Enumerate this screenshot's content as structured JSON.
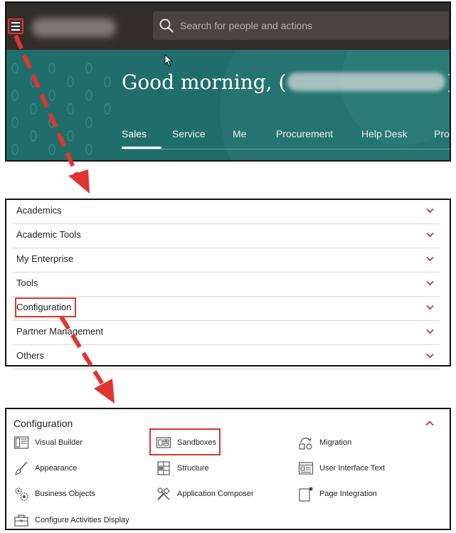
{
  "search": {
    "placeholder": "Search for people and actions"
  },
  "greeting": {
    "prefix": "Good morning, (",
    "suffix": ")!"
  },
  "tabs": [
    {
      "label": "Sales"
    },
    {
      "label": "Service"
    },
    {
      "label": "Me"
    },
    {
      "label": "Procurement"
    },
    {
      "label": "Help Desk"
    },
    {
      "label": "Pro"
    }
  ],
  "navigator": {
    "items": [
      {
        "label": "Academics"
      },
      {
        "label": "Academic Tools"
      },
      {
        "label": "My Enterprise"
      },
      {
        "label": "Tools"
      },
      {
        "label": "Configuration"
      },
      {
        "label": "Partner Management"
      },
      {
        "label": "Others"
      }
    ]
  },
  "configuration": {
    "title": "Configuration",
    "items": [
      {
        "label": "Visual Builder",
        "icon": "visual-builder-icon"
      },
      {
        "label": "Sandboxes",
        "icon": "sandboxes-icon"
      },
      {
        "label": "Migration",
        "icon": "migration-icon"
      },
      {
        "label": "Appearance",
        "icon": "paintbrush-icon"
      },
      {
        "label": "Structure",
        "icon": "structure-grid-icon"
      },
      {
        "label": "User Interface Text",
        "icon": "user-interface-text-icon"
      },
      {
        "label": "Business Objects",
        "icon": "gears-icon"
      },
      {
        "label": "Application Composer",
        "icon": "tools-icon"
      },
      {
        "label": "Page Integration",
        "icon": "page-integration-icon"
      },
      {
        "label": "Configure Activities Display",
        "icon": "toolbox-icon"
      }
    ]
  },
  "colors": {
    "topbar": "#332d2a",
    "banner": "#1f6e6b",
    "accent_red": "#e0342e",
    "chevron": "#c0392b"
  }
}
